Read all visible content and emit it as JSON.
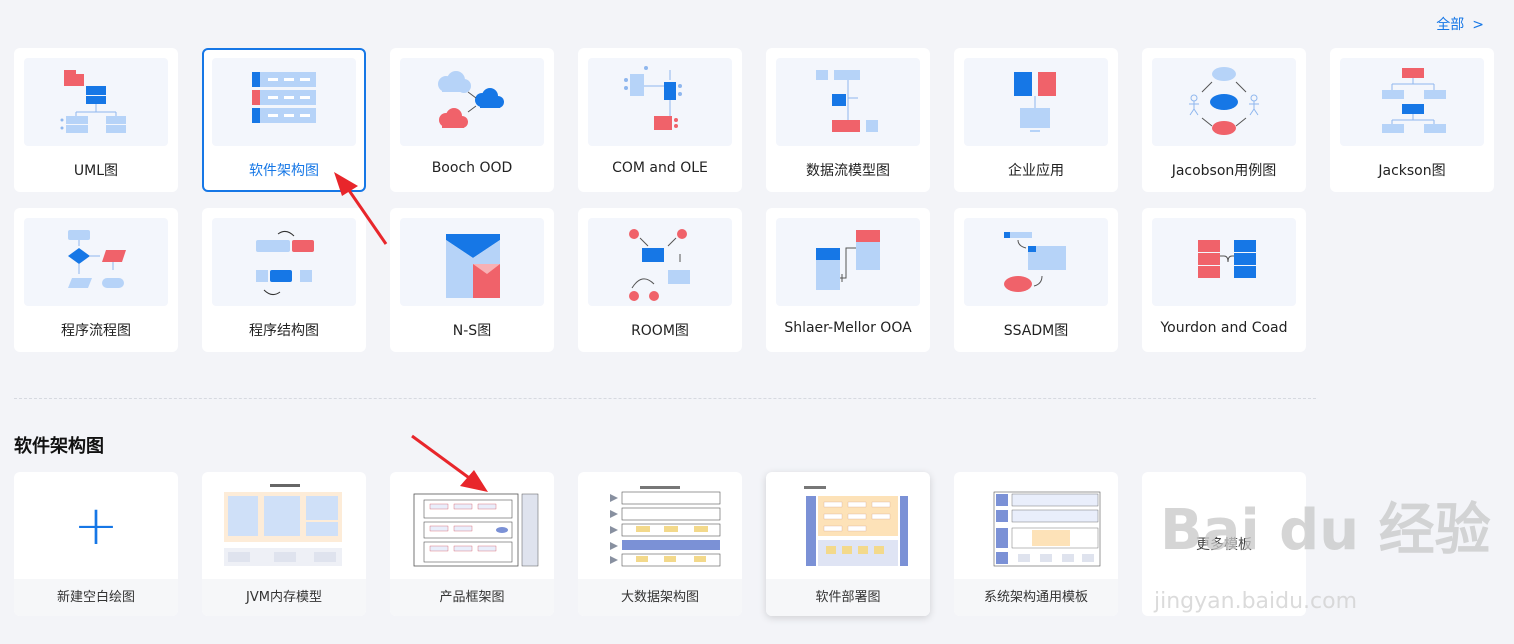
{
  "header": {
    "all_link": "全部",
    "all_chevron": ">"
  },
  "categories": [
    {
      "label": "UML图",
      "icon": "uml-diagram-icon"
    },
    {
      "label": "软件架构图",
      "icon": "software-architecture-icon",
      "selected": true
    },
    {
      "label": "Booch OOD",
      "icon": "booch-cloud-icon"
    },
    {
      "label": "COM and OLE",
      "icon": "com-ole-icon"
    },
    {
      "label": "数据流模型图",
      "icon": "data-flow-icon"
    },
    {
      "label": "企业应用",
      "icon": "enterprise-app-icon"
    },
    {
      "label": "Jacobson用例图",
      "icon": "use-case-icon"
    },
    {
      "label": "Jackson图",
      "icon": "jackson-tree-icon"
    },
    {
      "label": "程序流程图",
      "icon": "program-flow-icon"
    },
    {
      "label": "程序结构图",
      "icon": "program-structure-icon"
    },
    {
      "label": "N-S图",
      "icon": "ns-diagram-icon"
    },
    {
      "label": "ROOM图",
      "icon": "room-diagram-icon"
    },
    {
      "label": "Shlaer-Mellor OOA",
      "icon": "shlaer-mellor-icon"
    },
    {
      "label": "SSADM图",
      "icon": "ssadm-icon"
    },
    {
      "label": "Yourdon and Coad",
      "icon": "yourdon-coad-icon"
    }
  ],
  "section": {
    "title": "软件架构图"
  },
  "templates": [
    {
      "label": "新建空白绘图"
    },
    {
      "label": "JVM内存模型"
    },
    {
      "label": "产品框架图"
    },
    {
      "label": "大数据架构图"
    },
    {
      "label": "软件部署图"
    },
    {
      "label": "系统架构通用模板"
    },
    {
      "label": "更多模板"
    }
  ],
  "watermark": {
    "logo": "Bai du 经验",
    "url": "jingyan.baidu.com"
  },
  "colors": {
    "accent": "#1677e6",
    "red": "#f0626a",
    "light_blue": "#b6d3f8",
    "annotation_arrow": "#e8262b"
  }
}
